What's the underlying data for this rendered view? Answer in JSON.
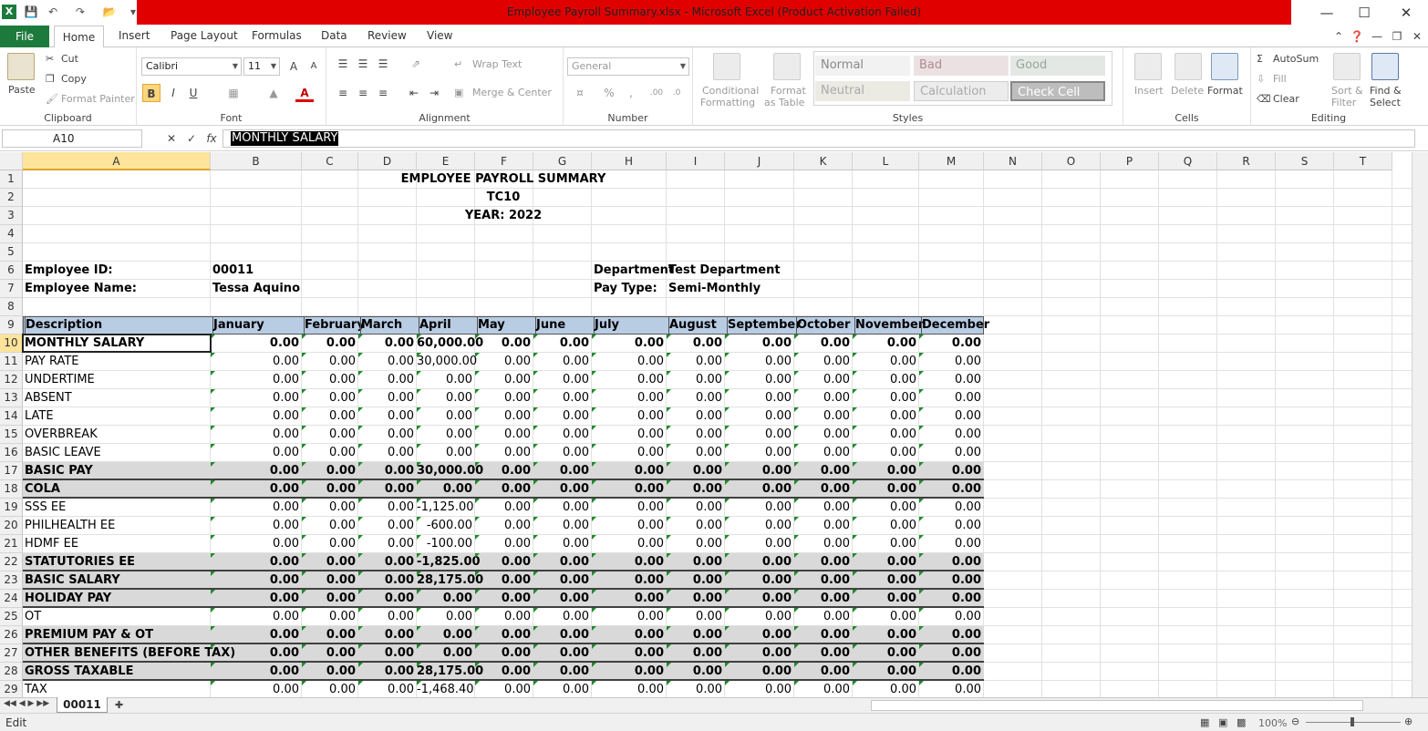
{
  "window": {
    "title": "Employee Payroll Summary.xlsx  -  Microsoft Excel (Product Activation Failed)",
    "accent": "#e00000"
  },
  "tabs": [
    "File",
    "Home",
    "Insert",
    "Page Layout",
    "Formulas",
    "Data",
    "Review",
    "View"
  ],
  "ribbon": {
    "clipboard": {
      "paste": "Paste",
      "cut": "Cut",
      "copy": "Copy",
      "format_painter": "Format Painter",
      "label": "Clipboard"
    },
    "font": {
      "name": "Calibri",
      "size": "11",
      "bold": "B",
      "italic": "I",
      "underline": "U",
      "label": "Font"
    },
    "alignment": {
      "wrap": "Wrap Text",
      "merge": "Merge & Center",
      "label": "Alignment"
    },
    "number": {
      "format": "General",
      "label": "Number"
    },
    "styles": {
      "conditional": "Conditional",
      "conditional2": "Formatting",
      "format_table": "Format",
      "format_table2": "as Table",
      "normal": "Normal",
      "bad": "Bad",
      "good": "Good",
      "neutral": "Neutral",
      "calculation": "Calculation",
      "check": "Check Cell",
      "label": "Styles"
    },
    "cells": {
      "insert": "Insert",
      "delete": "Delete",
      "format": "Format",
      "label": "Cells"
    },
    "editing": {
      "autosum": "AutoSum",
      "fill": "Fill",
      "clear": "Clear",
      "sort": "Sort &",
      "sort2": "Filter",
      "find": "Find &",
      "find2": "Select",
      "label": "Editing"
    }
  },
  "formula_bar": {
    "name_box": "A10",
    "value": "MONTHLY SALARY"
  },
  "columns": [
    "A",
    "B",
    "C",
    "D",
    "E",
    "F",
    "G",
    "H",
    "I",
    "J",
    "K",
    "L",
    "M",
    "N",
    "O",
    "P",
    "Q",
    "R",
    "S",
    "T"
  ],
  "rows": [
    "1",
    "2",
    "3",
    "4",
    "5",
    "6",
    "7",
    "8",
    "9",
    "10",
    "11",
    "12",
    "13",
    "14",
    "15",
    "16",
    "17",
    "18",
    "19",
    "20",
    "21",
    "22",
    "23",
    "24",
    "25",
    "26",
    "27",
    "28",
    "29"
  ],
  "sheet": {
    "title1": "EMPLOYEE PAYROLL SUMMARY",
    "title2": "TC10",
    "title3": "YEAR: 2022",
    "emp_id_label": "Employee ID:",
    "emp_id": "00011",
    "emp_name_label": "Employee Name:",
    "emp_name": "Tessa Aquino",
    "dept_label": "Department",
    "dept": "Test Department",
    "paytype_label": "Pay Type:",
    "paytype": "Semi-Monthly",
    "header": [
      "Description",
      "January",
      "February",
      "March",
      "April",
      "May",
      "June",
      "July",
      "August",
      "September",
      "October",
      "November",
      "December"
    ],
    "data": [
      {
        "d": "MONTHLY SALARY",
        "b": true,
        "g": false,
        "v": [
          "0.00",
          "0.00",
          "0.00",
          "60,000.00",
          "0.00",
          "0.00",
          "0.00",
          "0.00",
          "0.00",
          "0.00",
          "0.00",
          "0.00"
        ]
      },
      {
        "d": "PAY RATE",
        "b": false,
        "g": false,
        "v": [
          "0.00",
          "0.00",
          "0.00",
          "30,000.00",
          "0.00",
          "0.00",
          "0.00",
          "0.00",
          "0.00",
          "0.00",
          "0.00",
          "0.00"
        ]
      },
      {
        "d": "UNDERTIME",
        "b": false,
        "g": false,
        "v": [
          "0.00",
          "0.00",
          "0.00",
          "0.00",
          "0.00",
          "0.00",
          "0.00",
          "0.00",
          "0.00",
          "0.00",
          "0.00",
          "0.00"
        ]
      },
      {
        "d": "ABSENT",
        "b": false,
        "g": false,
        "v": [
          "0.00",
          "0.00",
          "0.00",
          "0.00",
          "0.00",
          "0.00",
          "0.00",
          "0.00",
          "0.00",
          "0.00",
          "0.00",
          "0.00"
        ]
      },
      {
        "d": "LATE",
        "b": false,
        "g": false,
        "v": [
          "0.00",
          "0.00",
          "0.00",
          "0.00",
          "0.00",
          "0.00",
          "0.00",
          "0.00",
          "0.00",
          "0.00",
          "0.00",
          "0.00"
        ]
      },
      {
        "d": "OVERBREAK",
        "b": false,
        "g": false,
        "v": [
          "0.00",
          "0.00",
          "0.00",
          "0.00",
          "0.00",
          "0.00",
          "0.00",
          "0.00",
          "0.00",
          "0.00",
          "0.00",
          "0.00"
        ]
      },
      {
        "d": "BASIC LEAVE",
        "b": false,
        "g": false,
        "v": [
          "0.00",
          "0.00",
          "0.00",
          "0.00",
          "0.00",
          "0.00",
          "0.00",
          "0.00",
          "0.00",
          "0.00",
          "0.00",
          "0.00"
        ]
      },
      {
        "d": "BASIC PAY",
        "b": true,
        "g": true,
        "v": [
          "0.00",
          "0.00",
          "0.00",
          "30,000.00",
          "0.00",
          "0.00",
          "0.00",
          "0.00",
          "0.00",
          "0.00",
          "0.00",
          "0.00"
        ]
      },
      {
        "d": "COLA",
        "b": true,
        "g": true,
        "v": [
          "0.00",
          "0.00",
          "0.00",
          "0.00",
          "0.00",
          "0.00",
          "0.00",
          "0.00",
          "0.00",
          "0.00",
          "0.00",
          "0.00"
        ]
      },
      {
        "d": "SSS EE",
        "b": false,
        "g": false,
        "v": [
          "0.00",
          "0.00",
          "0.00",
          "-1,125.00",
          "0.00",
          "0.00",
          "0.00",
          "0.00",
          "0.00",
          "0.00",
          "0.00",
          "0.00"
        ]
      },
      {
        "d": "PHILHEALTH EE",
        "b": false,
        "g": false,
        "v": [
          "0.00",
          "0.00",
          "0.00",
          "-600.00",
          "0.00",
          "0.00",
          "0.00",
          "0.00",
          "0.00",
          "0.00",
          "0.00",
          "0.00"
        ]
      },
      {
        "d": "HDMF EE",
        "b": false,
        "g": false,
        "v": [
          "0.00",
          "0.00",
          "0.00",
          "-100.00",
          "0.00",
          "0.00",
          "0.00",
          "0.00",
          "0.00",
          "0.00",
          "0.00",
          "0.00"
        ]
      },
      {
        "d": "STATUTORIES EE",
        "b": true,
        "g": true,
        "v": [
          "0.00",
          "0.00",
          "0.00",
          "-1,825.00",
          "0.00",
          "0.00",
          "0.00",
          "0.00",
          "0.00",
          "0.00",
          "0.00",
          "0.00"
        ]
      },
      {
        "d": "BASIC SALARY",
        "b": true,
        "g": true,
        "v": [
          "0.00",
          "0.00",
          "0.00",
          "28,175.00",
          "0.00",
          "0.00",
          "0.00",
          "0.00",
          "0.00",
          "0.00",
          "0.00",
          "0.00"
        ]
      },
      {
        "d": "HOLIDAY PAY",
        "b": true,
        "g": true,
        "v": [
          "0.00",
          "0.00",
          "0.00",
          "0.00",
          "0.00",
          "0.00",
          "0.00",
          "0.00",
          "0.00",
          "0.00",
          "0.00",
          "0.00"
        ]
      },
      {
        "d": "OT",
        "b": false,
        "g": false,
        "v": [
          "0.00",
          "0.00",
          "0.00",
          "0.00",
          "0.00",
          "0.00",
          "0.00",
          "0.00",
          "0.00",
          "0.00",
          "0.00",
          "0.00"
        ]
      },
      {
        "d": "PREMIUM PAY & OT",
        "b": true,
        "g": true,
        "v": [
          "0.00",
          "0.00",
          "0.00",
          "0.00",
          "0.00",
          "0.00",
          "0.00",
          "0.00",
          "0.00",
          "0.00",
          "0.00",
          "0.00"
        ]
      },
      {
        "d": "OTHER BENEFITS (BEFORE TAX)",
        "b": true,
        "g": true,
        "v": [
          "0.00",
          "0.00",
          "0.00",
          "0.00",
          "0.00",
          "0.00",
          "0.00",
          "0.00",
          "0.00",
          "0.00",
          "0.00",
          "0.00"
        ]
      },
      {
        "d": "GROSS TAXABLE",
        "b": true,
        "g": true,
        "v": [
          "0.00",
          "0.00",
          "0.00",
          "28,175.00",
          "0.00",
          "0.00",
          "0.00",
          "0.00",
          "0.00",
          "0.00",
          "0.00",
          "0.00"
        ]
      },
      {
        "d": "TAX",
        "b": false,
        "g": false,
        "v": [
          "0.00",
          "0.00",
          "0.00",
          "-1,468.40",
          "0.00",
          "0.00",
          "0.00",
          "0.00",
          "0.00",
          "0.00",
          "0.00",
          "0.00"
        ]
      }
    ]
  },
  "sheet_tab": "00011",
  "status": {
    "mode": "Edit",
    "zoom": "100%"
  }
}
